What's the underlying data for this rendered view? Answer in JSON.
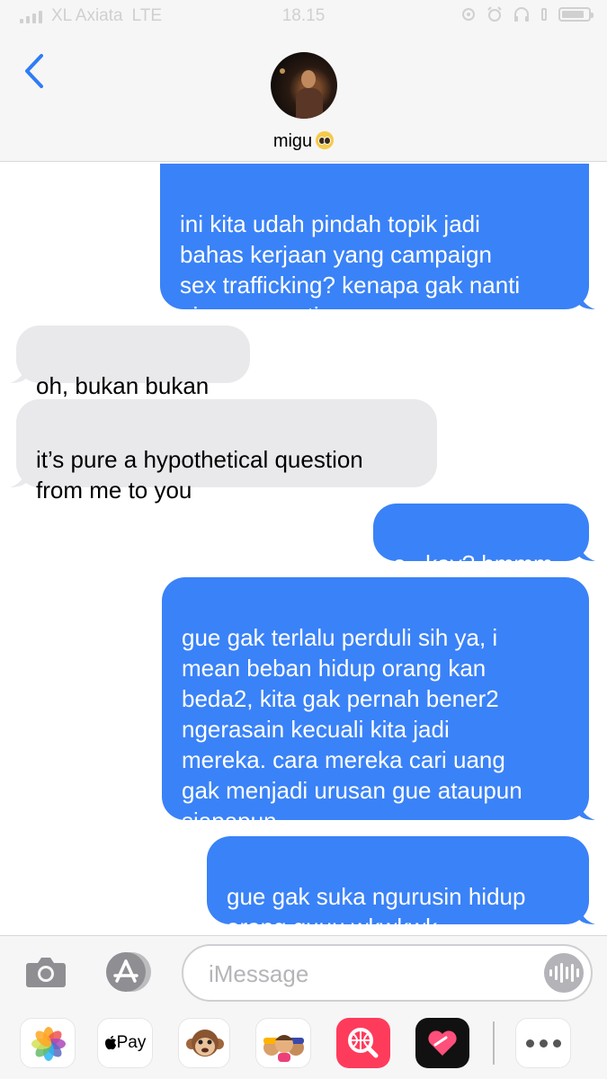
{
  "status_bar": {
    "carrier": "XL Axiata",
    "network": "LTE",
    "time": "18.15"
  },
  "contact": {
    "name": "migu"
  },
  "messages": [
    {
      "direction": "outgoing",
      "text": "ini kita udah pindah topik jadi\nbahas kerjaan yang campaign\nsex trafficking? kenapa gak nanti\naja pas meeting"
    },
    {
      "direction": "incoming",
      "text": "oh, bukan bukan"
    },
    {
      "direction": "incoming",
      "text": "it’s pure a hypothetical question\nfrom me to you"
    },
    {
      "direction": "outgoing",
      "text": "o...kay? hmmm"
    },
    {
      "direction": "outgoing",
      "text": "gue gak terlalu perduli sih ya, i\nmean beban hidup orang kan\nbeda2, kita gak pernah bener2\nngerasain kecuali kita jadi\nmereka. cara mereka cari uang\ngak menjadi urusan gue ataupun\nsiapapun"
    },
    {
      "direction": "outgoing",
      "text": "gue gak suka ngurusin hidup\norang guuu wkwkwk"
    }
  ],
  "composer": {
    "placeholder": "iMessage",
    "apps": [
      {
        "name": "photos-icon"
      },
      {
        "name": "apple-pay-icon",
        "label": "Pay"
      },
      {
        "name": "animoji-icon"
      },
      {
        "name": "memoji-icon"
      },
      {
        "name": "web-search-icon"
      },
      {
        "name": "heart-app-icon"
      },
      {
        "name": "more-icon"
      }
    ]
  },
  "colors": {
    "outgoing_bubble": "#3a82f7",
    "incoming_bubble": "#e9e9eb",
    "accent": "#2f7cf6"
  }
}
